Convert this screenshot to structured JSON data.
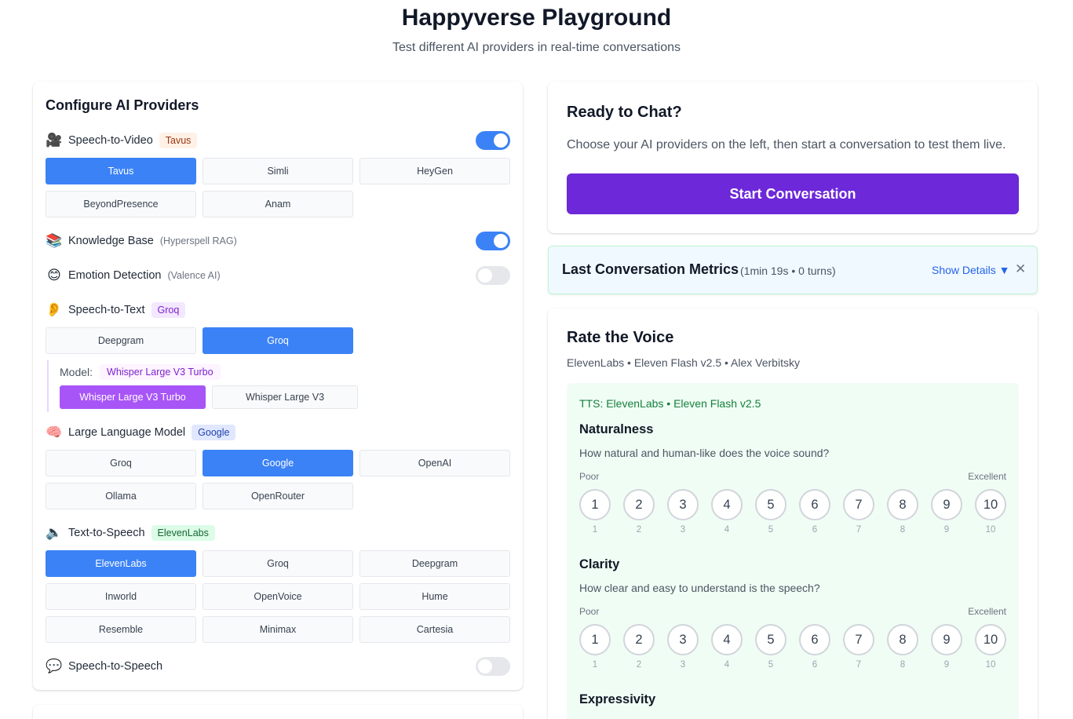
{
  "header": {
    "title": "Happyverse Playground",
    "subtitle": "Test different AI providers in real-time conversations"
  },
  "config": {
    "title": "Configure AI Providers",
    "speech_to_video": {
      "label": "Speech-to-Video",
      "icon": "video-camera-icon",
      "badge": "Tavus",
      "enabled": true,
      "options": [
        "Tavus",
        "Simli",
        "HeyGen",
        "BeyondPresence",
        "Anam"
      ],
      "selected": "Tavus"
    },
    "knowledge_base": {
      "label": "Knowledge Base",
      "icon": "books-icon",
      "note": "(Hyperspell RAG)",
      "enabled": true
    },
    "emotion": {
      "label": "Emotion Detection",
      "icon": "smiley-icon",
      "note": "(Valence AI)",
      "enabled": false
    },
    "speech_to_text": {
      "label": "Speech-to-Text",
      "icon": "ear-icon",
      "badge": "Groq",
      "options": [
        "Deepgram",
        "Groq"
      ],
      "selected": "Groq",
      "model_label": "Model:",
      "model_badge": "Whisper Large V3 Turbo",
      "models": [
        "Whisper Large V3 Turbo",
        "Whisper Large V3"
      ],
      "selected_model": "Whisper Large V3 Turbo"
    },
    "llm": {
      "label": "Large Language Model",
      "icon": "brain-icon",
      "badge": "Google",
      "options": [
        "Groq",
        "Google",
        "OpenAI",
        "Ollama",
        "OpenRouter"
      ],
      "selected": "Google"
    },
    "tts": {
      "label": "Text-to-Speech",
      "icon": "speaker-icon",
      "badge": "ElevenLabs",
      "options": [
        "ElevenLabs",
        "Groq",
        "Deepgram",
        "Inworld",
        "OpenVoice",
        "Hume",
        "Resemble",
        "Minimax",
        "Cartesia"
      ],
      "selected": "ElevenLabs"
    },
    "sts": {
      "label": "Speech-to-Speech",
      "icon": "speech-bubble-icon",
      "enabled": false
    }
  },
  "ready": {
    "title": "Ready to Chat?",
    "description": "Choose your AI providers on the left, then start a conversation to test them live.",
    "start_label": "Start Conversation"
  },
  "metrics": {
    "title": "Last Conversation Metrics",
    "summary": "(1min 19s • 0 turns)",
    "show_details": "Show Details ▼",
    "close": "✕"
  },
  "rating": {
    "title": "Rate the Voice",
    "subtitle": "ElevenLabs • Eleven Flash v2.5 • Alex Verbitsky",
    "tts_label": "TTS: ElevenLabs • Eleven Flash v2.5",
    "poor": "Poor",
    "excellent": "Excellent",
    "scale": [
      "1",
      "2",
      "3",
      "4",
      "5",
      "6",
      "7",
      "8",
      "9",
      "10"
    ],
    "criteria": [
      {
        "title": "Naturalness",
        "question": "How natural and human-like does the voice sound?"
      },
      {
        "title": "Clarity",
        "question": "How clear and easy to understand is the speech?"
      },
      {
        "title": "Expressivity",
        "question": ""
      }
    ]
  },
  "colors": {
    "primary_blue": "#3b82f6",
    "purple": "#a855f7",
    "start_button": "#6d28d9"
  }
}
